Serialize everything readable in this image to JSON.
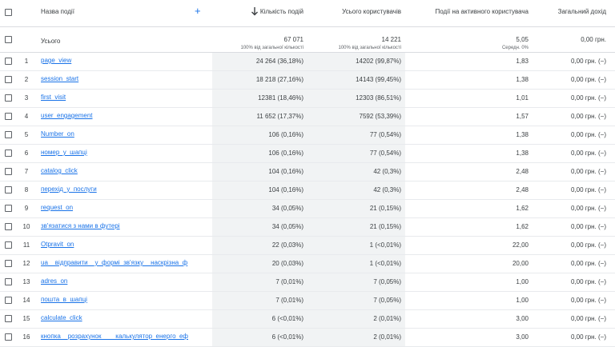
{
  "header": {
    "event_name": "Назва події",
    "add_label": "+",
    "col_event_count": "Кількість подій",
    "col_total_users": "Усього користувачів",
    "col_events_per_user": "Події на активного користувача",
    "col_total_revenue": "Загальний дохід"
  },
  "totals": {
    "label": "Усього",
    "event_count": "67 071",
    "event_count_sub": "100% від загальної кількості",
    "total_users": "14 221",
    "total_users_sub": "100% від загальної кількості",
    "events_per_user": "5,05",
    "events_per_user_sub": "Середн. 0%",
    "revenue": "0,00 грн."
  },
  "rows": [
    {
      "n": "1",
      "name": "page_view",
      "events": "24 264 (36,18%)",
      "users": "14202 (99,87%)",
      "epu": "1,83",
      "revenue": "0,00 грн. (−)"
    },
    {
      "n": "2",
      "name": "session_start",
      "events": "18 218 (27,16%)",
      "users": "14143 (99,45%)",
      "epu": "1,38",
      "revenue": "0,00 грн. (−)"
    },
    {
      "n": "3",
      "name": "first_visit",
      "events": "12381 (18,46%)",
      "users": "12303 (86,51%)",
      "epu": "1,01",
      "revenue": "0,00 грн. (−)"
    },
    {
      "n": "4",
      "name": "user_engagement",
      "events": "11 652 (17,37%)",
      "users": "7592 (53,39%)",
      "epu": "1,57",
      "revenue": "0,00 грн. (−)"
    },
    {
      "n": "5",
      "name": "Number_on",
      "events": "106 (0,16%)",
      "users": "77 (0,54%)",
      "epu": "1,38",
      "revenue": "0,00 грн. (−)"
    },
    {
      "n": "6",
      "name": "номер_у_шапці",
      "events": "106 (0,16%)",
      "users": "77 (0,54%)",
      "epu": "1,38",
      "revenue": "0,00 грн. (−)"
    },
    {
      "n": "7",
      "name": "catalog_click",
      "events": "104 (0,16%)",
      "users": "42 (0,3%)",
      "epu": "2,48",
      "revenue": "0,00 грн. (−)"
    },
    {
      "n": "8",
      "name": "перехід_у_послуги",
      "events": "104 (0,16%)",
      "users": "42 (0,3%)",
      "epu": "2,48",
      "revenue": "0,00 грн. (−)"
    },
    {
      "n": "9",
      "name": "request_on",
      "events": "34 (0,05%)",
      "users": "21 (0,15%)",
      "epu": "1,62",
      "revenue": "0,00 грн. (−)"
    },
    {
      "n": "10",
      "name": "зв'язатися з нами в футері",
      "events": "34 (0,05%)",
      "users": "21 (0,15%)",
      "epu": "1,62",
      "revenue": "0,00 грн. (−)"
    },
    {
      "n": "11",
      "name": "Otpravit_on",
      "events": "22 (0,03%)",
      "users": "1 (<0,01%)",
      "epu": "22,00",
      "revenue": "0,00 грн. (−)"
    },
    {
      "n": "12",
      "name": "ua__відправити__у_формі_зв'язку__наскрізна_ф",
      "events": "20 (0,03%)",
      "users": "1 (<0,01%)",
      "epu": "20,00",
      "revenue": "0,00 грн. (−)"
    },
    {
      "n": "13",
      "name": "adres_on",
      "events": "7 (0,01%)",
      "users": "7 (0,05%)",
      "epu": "1,00",
      "revenue": "0,00 грн. (−)"
    },
    {
      "n": "14",
      "name": "пошта_в_шапці",
      "events": "7 (0,01%)",
      "users": "7 (0,05%)",
      "epu": "1,00",
      "revenue": "0,00 грн. (−)"
    },
    {
      "n": "15",
      "name": "calculate_click",
      "events": "6 (<0,01%)",
      "users": "2 (0,01%)",
      "epu": "3,00",
      "revenue": "0,00 грн. (−)"
    },
    {
      "n": "16",
      "name": "кнопка__розрахунок____калькулятор_енерго_еф",
      "events": "6 (<0,01%)",
      "users": "2 (0,01%)",
      "epu": "3,00",
      "revenue": "0,00 грн. (−)"
    }
  ]
}
